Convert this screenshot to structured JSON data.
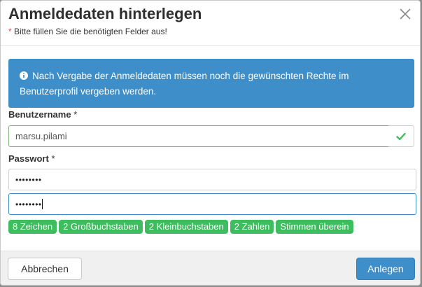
{
  "dialog": {
    "title": "Anmeldedaten hinterlegen",
    "subtitle_marker": "*",
    "subtitle": " Bitte füllen Sie die benötigten Felder aus!",
    "close_icon": "close-icon"
  },
  "alert": {
    "icon": "info-icon",
    "text": "Nach Vergabe der Anmeldedaten müssen noch die gewünschten Rechte im Benutzerprofil vergeben werden."
  },
  "username": {
    "label": "Benutzername",
    "required_marker": "*",
    "value": "marsu.pilami",
    "status_icon": "check-icon"
  },
  "password": {
    "label": "Passwort",
    "required_marker": "*",
    "value_masked": "••••••••",
    "confirm_masked": "••••••••"
  },
  "rules": [
    "8 Zeichen",
    "2 Großbuchstaben",
    "2 Kleinbuchstaben",
    "2 Zahlen",
    "Stimmen überein"
  ],
  "footer": {
    "cancel_label": "Abbrechen",
    "save_label": "Anlegen"
  },
  "colors": {
    "primary": "#3d8ec9",
    "success": "#3dbd5e"
  }
}
